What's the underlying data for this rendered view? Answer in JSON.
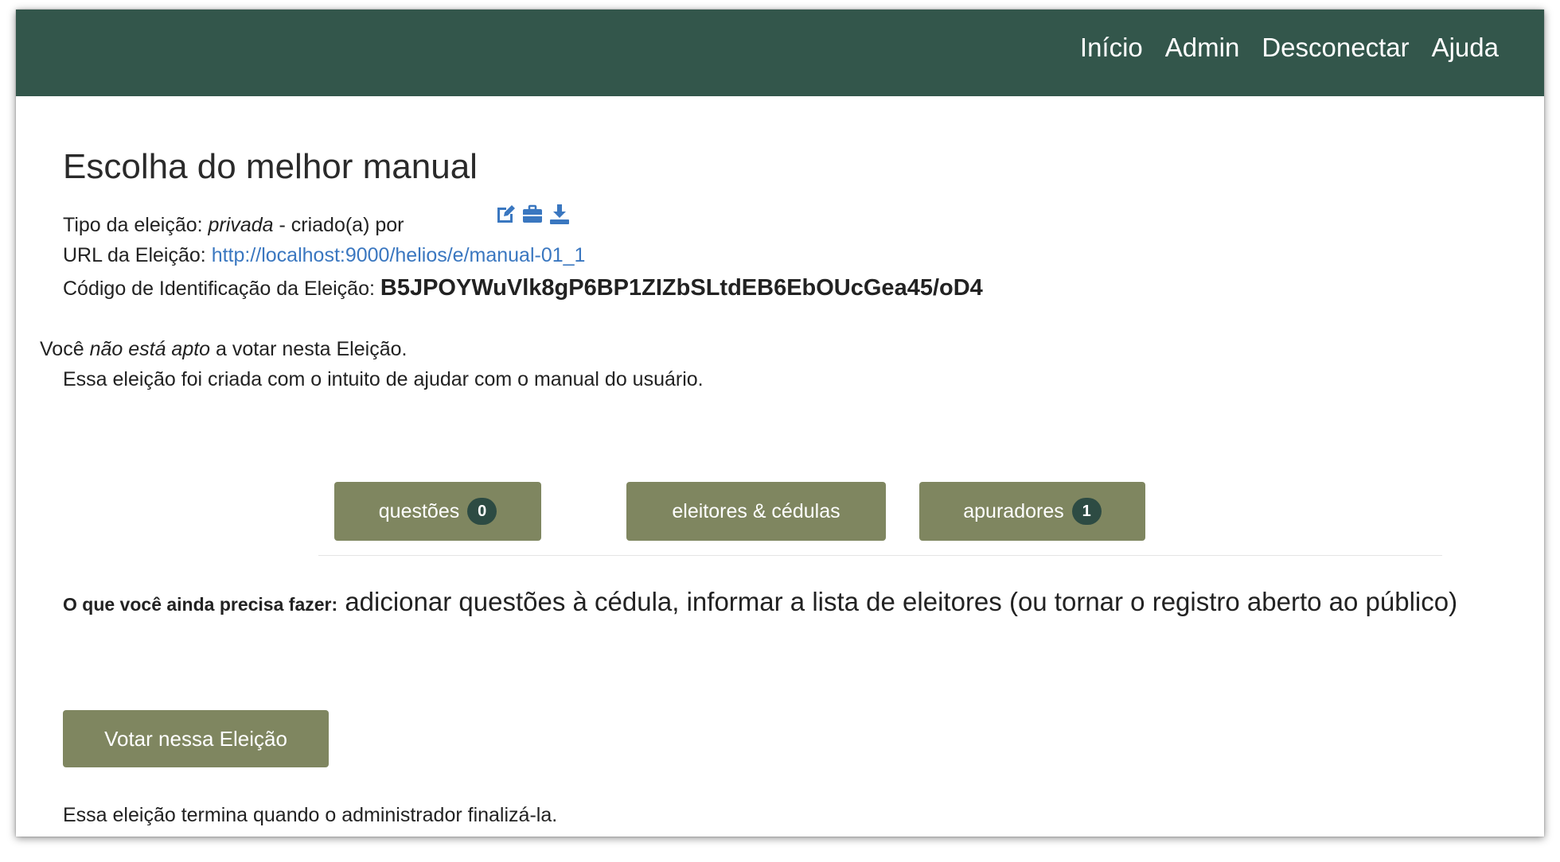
{
  "nav": {
    "items": [
      "Início",
      "Admin",
      "Desconectar",
      "Ajuda"
    ]
  },
  "election": {
    "title": "Escolha do melhor manual",
    "type_label": "Tipo da eleição:",
    "type_value": "privada",
    "created_by": "- criado(a) por",
    "url_label": "URL da Eleição:",
    "url_value": "http://localhost:9000/helios/e/manual-01_1",
    "code_label": "Código de Identificação da Eleição:",
    "code_value": "B5JPOYWuVlk8gP6BP1ZIZbSLtdEB6EbOUcGea45/oD4",
    "not_eligible_prefix": "Você",
    "not_eligible_em": "não está apto",
    "not_eligible_suffix": "a votar nesta Eleição.",
    "description": "Essa eleição foi criada com o intuito de ajudar com o manual do usuário."
  },
  "icons": [
    "edit-icon",
    "briefcase-icon",
    "download-icon"
  ],
  "tabs": {
    "questions": {
      "label": "questões",
      "count": "0"
    },
    "voters": {
      "label": "eleitores & cédulas"
    },
    "trustees": {
      "label": "apuradores",
      "count": "1"
    }
  },
  "todo": {
    "label": "O que você ainda precisa fazer:",
    "text": "adicionar questões à cédula, informar a lista de eleitores (ou tornar o registro aberto ao público)"
  },
  "vote_button": "Votar nessa Eleição",
  "end_note": "Essa eleição termina quando o administrador finalizá-la.",
  "colors": {
    "navbar": "#33564b",
    "button": "#7f8660",
    "badge": "#2d4b43",
    "link": "#3a77c0",
    "icon": "#3a77c0"
  }
}
